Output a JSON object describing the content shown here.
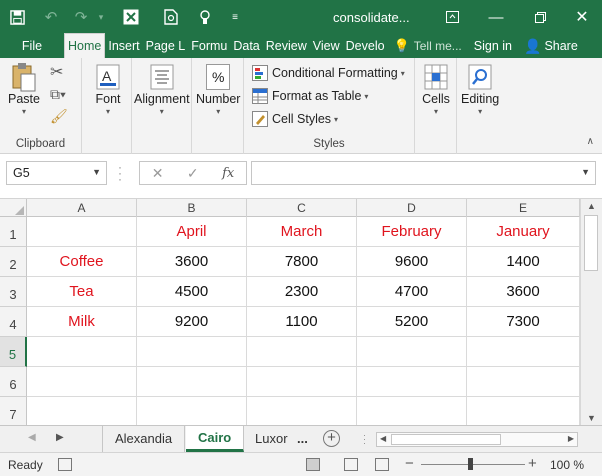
{
  "title_bar": {
    "file_name": "consolidate...",
    "icons": [
      "save-icon",
      "undo-icon",
      "redo-icon",
      "excel-icon",
      "print-preview-icon",
      "touch-mode-icon",
      "customize-icon",
      "ribbon-display-icon",
      "minimize-icon",
      "restore-icon",
      "close-icon"
    ]
  },
  "tabs": [
    {
      "label": "File"
    },
    {
      "label": "Home",
      "active": true
    },
    {
      "label": "Insert"
    },
    {
      "label": "Page L"
    },
    {
      "label": "Formu"
    },
    {
      "label": "Data"
    },
    {
      "label": "Review"
    },
    {
      "label": "View"
    },
    {
      "label": "Develo"
    }
  ],
  "tell_me": "Tell me...",
  "sign_in": "Sign in",
  "share": "Share",
  "ribbon": {
    "clipboard": {
      "label": "Clipboard",
      "paste": "Paste"
    },
    "font": "Font",
    "alignment": "Alignment",
    "number": {
      "label": "Number",
      "icon_text": "%"
    },
    "styles": {
      "label": "Styles",
      "conditional": "Conditional Formatting",
      "format_table": "Format as Table",
      "cell_styles": "Cell Styles"
    },
    "cells": "Cells",
    "editing": "Editing"
  },
  "formula_bar": {
    "name_box": "G5",
    "fx": "fx",
    "formula": ""
  },
  "columns": [
    "A",
    "B",
    "C",
    "D",
    "E"
  ],
  "rows": [
    "1",
    "2",
    "3",
    "4",
    "5",
    "6",
    "7"
  ],
  "cells": {
    "r1": [
      "",
      "April",
      "March",
      "February",
      "January"
    ],
    "r2": [
      "Coffee",
      "3600",
      "7800",
      "9600",
      "1400"
    ],
    "r3": [
      "Tea",
      "4500",
      "2300",
      "4700",
      "3600"
    ],
    "r4": [
      "Milk",
      "9200",
      "1100",
      "5200",
      "7300"
    ]
  },
  "colors": {
    "accent": "#217346",
    "label_red": "#e0141e"
  },
  "sheet_tabs": [
    {
      "label": "Alexandia"
    },
    {
      "label": "Cairo",
      "active": true
    },
    {
      "label": "Luxor"
    }
  ],
  "sheet_more": "...",
  "status": {
    "ready": "Ready",
    "zoom": "100 %"
  }
}
